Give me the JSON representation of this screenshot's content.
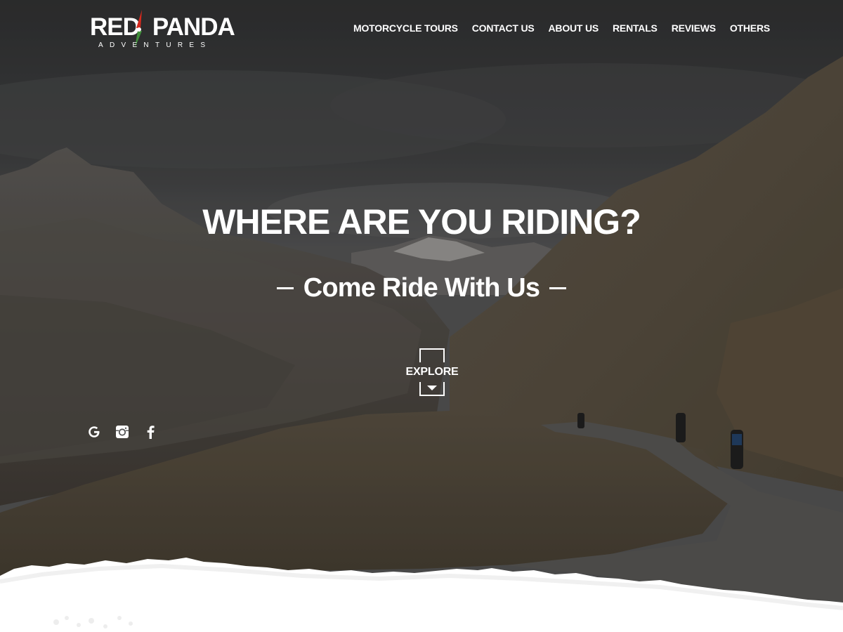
{
  "brand": {
    "name_left": "RED",
    "name_right": "PANDA",
    "tagline": "ADVENTURES",
    "colors": {
      "mark_red": "#d42a1e",
      "mark_green": "#3f8f3a",
      "text": "#ffffff"
    }
  },
  "nav": {
    "items": [
      {
        "label": "MOTORCYCLE TOURS"
      },
      {
        "label": "CONTACT US"
      },
      {
        "label": "ABOUT US"
      },
      {
        "label": "RENTALS"
      },
      {
        "label": "REVIEWS"
      },
      {
        "label": "OTHERS"
      }
    ]
  },
  "hero": {
    "title": "WHERE ARE YOU RIDING?",
    "subtitle": "Come Ride With Us",
    "explore_label": "EXPLORE"
  },
  "social": {
    "icons": [
      "google-icon",
      "instagram-icon",
      "facebook-icon"
    ]
  }
}
